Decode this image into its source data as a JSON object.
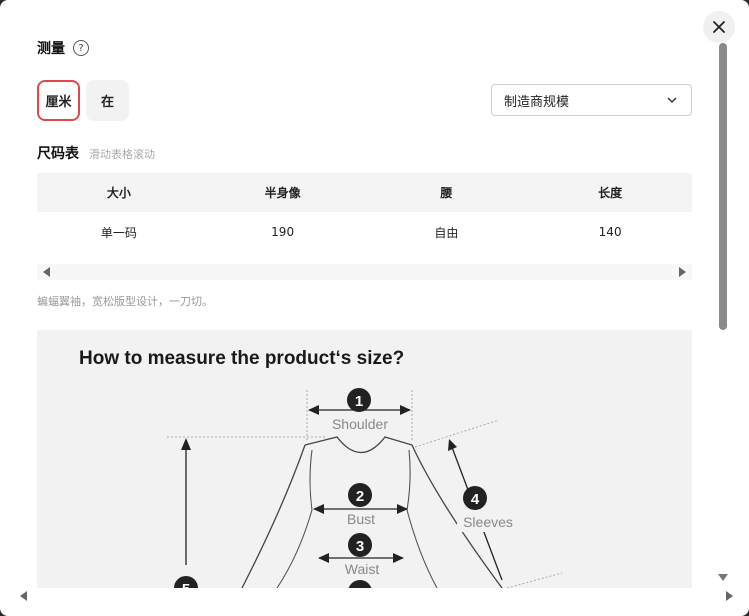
{
  "header": {
    "title": "测量",
    "help_icon": "question-circle-icon"
  },
  "units": {
    "cm_label": "厘米",
    "in_label": "在",
    "selected": "厘米",
    "accent_color": "#e2474b"
  },
  "size_select": {
    "value": "制造商规模"
  },
  "size_chart": {
    "title": "尺码表",
    "hint": "滑动表格滚动",
    "columns": [
      "大小",
      "半身像",
      "腰",
      "长度"
    ],
    "rows": [
      [
        "单一码",
        "190",
        "自由",
        "140"
      ]
    ]
  },
  "note": "蝙蝠翼袖，宽松版型设计，一刀切。",
  "guide": {
    "heading": "How to measure the product‘s size?",
    "labels": {
      "shoulder": "Shoulder",
      "bust": "Bust",
      "waist": "Waist",
      "sleeves": "Sleeves"
    },
    "numbers": {
      "shoulder": "1",
      "bust": "2",
      "waist": "3",
      "sleeves": "4",
      "length": "5"
    }
  }
}
